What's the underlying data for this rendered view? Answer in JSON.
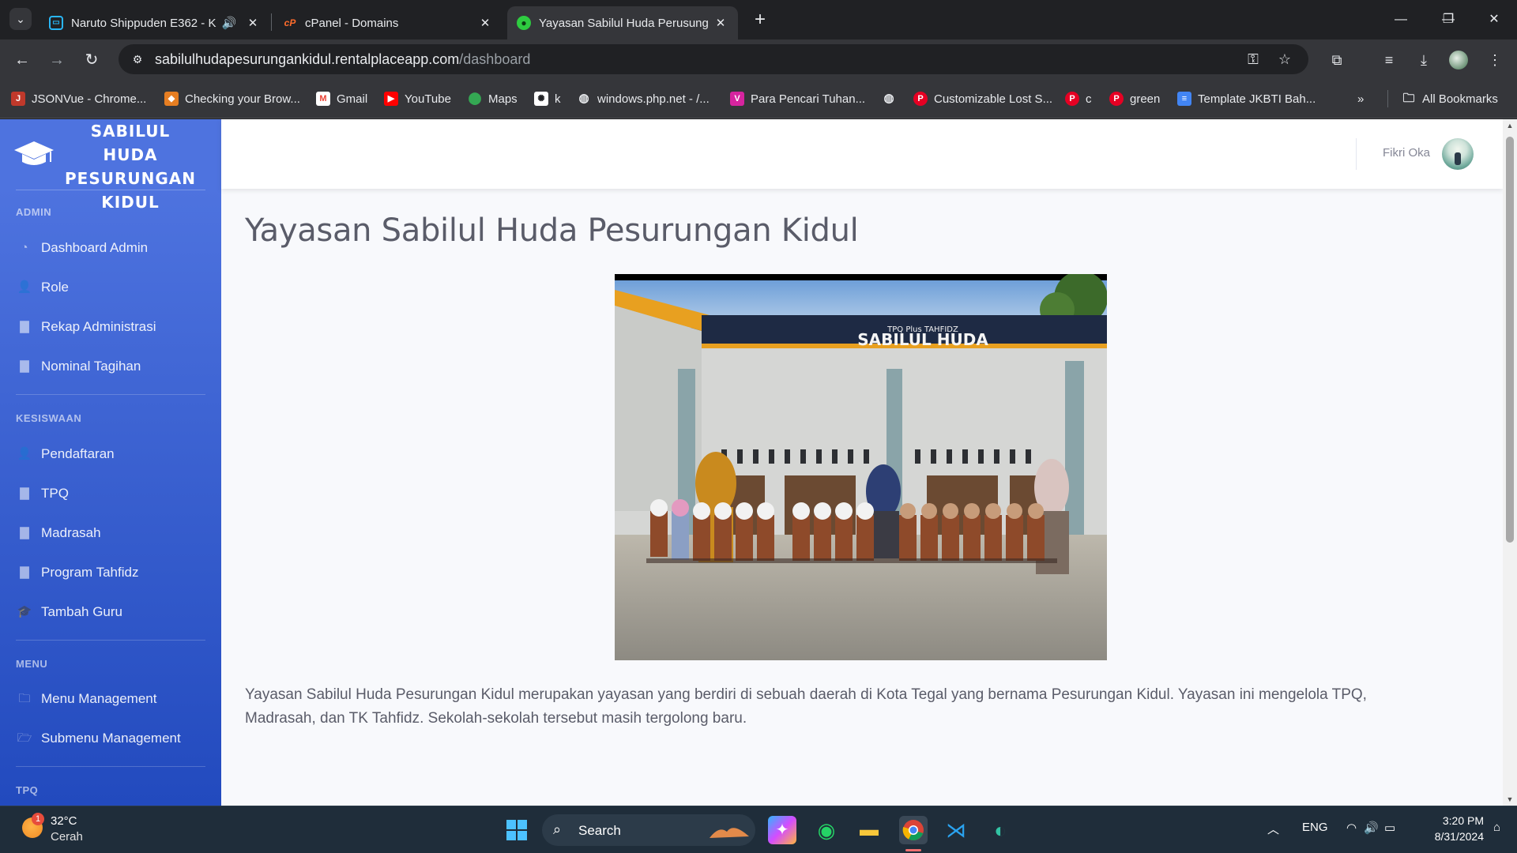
{
  "browser": {
    "tabs": [
      {
        "title": "Naruto Shippuden E362 - K",
        "active": false
      },
      {
        "title": "cPanel - Domains",
        "active": false
      },
      {
        "title": "Yayasan Sabilul Huda Perusung",
        "active": true
      }
    ],
    "url_host": "sabilulhudapesurungankidul.rentalplaceapp.com",
    "url_path": "/dashboard",
    "bookmarks": [
      "JSONVue - Chrome...",
      "Checking your Brow...",
      "Gmail",
      "YouTube",
      "Maps",
      "k",
      "windows.php.net - /...",
      "Para Pencari Tuhan...",
      "Customizable Lost S...",
      "c",
      "green",
      "Template JKBTI Bah..."
    ],
    "all_bookmarks_label": "All Bookmarks"
  },
  "sidebar": {
    "brand_lines": [
      "SABILUL",
      "HUDA",
      "PESURUNGAN",
      "KIDUL"
    ],
    "sections": [
      {
        "heading": "ADMIN",
        "items": [
          "Dashboard Admin",
          "Role",
          "Rekap Administrasi",
          "Nominal Tagihan"
        ]
      },
      {
        "heading": "KESISWAAN",
        "items": [
          "Pendaftaran",
          "TPQ",
          "Madrasah",
          "Program Tahfidz",
          "Tambah Guru"
        ]
      },
      {
        "heading": "MENU",
        "items": [
          "Menu Management",
          "Submenu Management"
        ]
      },
      {
        "heading": "TPQ",
        "items": []
      }
    ]
  },
  "topbar": {
    "user_name": "Fikri Oka"
  },
  "main": {
    "title": "Yayasan Sabilul Huda Pesurungan Kidul",
    "photo_sign_small": "TPQ Plus TAHFIDZ",
    "photo_sign_big": "SABILUL HUDA",
    "description": "Yayasan Sabilul Huda Pesurungan Kidul merupakan yayasan yang berdiri di sebuah daerah di Kota Tegal yang bernama Pesurungan Kidul. Yayasan ini mengelola TPQ, Madrasah, dan TK Tahfidz. Sekolah-sekolah tersebut masih tergolong baru."
  },
  "taskbar": {
    "weather_temp": "32°C",
    "weather_desc": "Cerah",
    "weather_badge": "1",
    "search_label": "Search",
    "language": "ENG",
    "time": "3:20 PM",
    "date": "8/31/2024"
  },
  "colors": {
    "sidebar_top": "#4e73df",
    "sidebar_bottom": "#224abe",
    "page_bg": "#f8f9fc",
    "text_gray": "#5a5c69"
  }
}
